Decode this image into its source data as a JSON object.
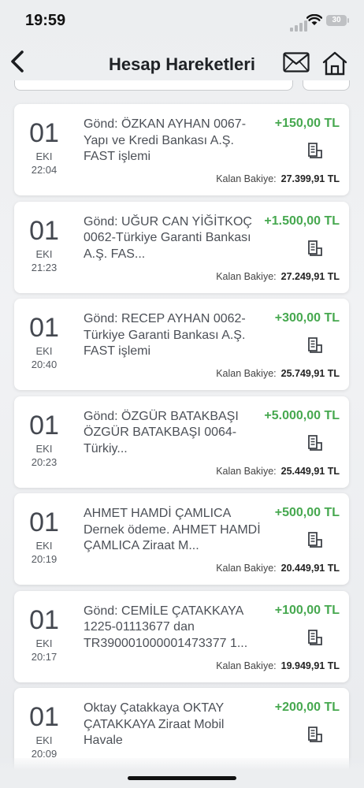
{
  "status_bar": {
    "time": "19:59",
    "battery": "30"
  },
  "header": {
    "title": "Hesap Hareketleri"
  },
  "transactions": [
    {
      "day": "01",
      "month": "EKI",
      "time": "22:04",
      "description": "Gönd: ÖZKAN AYHAN 0067-Yapı ve Kredi Bankası A.Ş. FAST işlemi",
      "amount": "+150,00 TL",
      "balance_label": "Kalan Bakiye:",
      "balance": "27.399,91 TL"
    },
    {
      "day": "01",
      "month": "EKI",
      "time": "21:23",
      "description": "Gönd: UĞUR CAN YİĞİTKOÇ 0062-Türkiye Garanti Bankası A.Ş. FAS...",
      "amount": "+1.500,00 TL",
      "balance_label": "Kalan Bakiye:",
      "balance": "27.249,91 TL"
    },
    {
      "day": "01",
      "month": "EKI",
      "time": "20:40",
      "description": "Gönd: RECEP AYHAN 0062-Türkiye Garanti Bankası A.Ş. FAST işlemi",
      "amount": "+300,00 TL",
      "balance_label": "Kalan Bakiye:",
      "balance": "25.749,91 TL"
    },
    {
      "day": "01",
      "month": "EKI",
      "time": "20:23",
      "description": "Gönd: ÖZGÜR BATAKBAŞI ÖZGÜR BATAKBAŞI 0064-Türkiy...",
      "amount": "+5.000,00 TL",
      "balance_label": "Kalan Bakiye:",
      "balance": "25.449,91 TL"
    },
    {
      "day": "01",
      "month": "EKI",
      "time": "20:19",
      "description": "AHMET HAMDİ ÇAMLICA Dernek ödeme. AHMET HAMDİ ÇAMLICA Ziraat M...",
      "amount": "+500,00 TL",
      "balance_label": "Kalan Bakiye:",
      "balance": "20.449,91 TL"
    },
    {
      "day": "01",
      "month": "EKI",
      "time": "20:17",
      "description": "Gönd: CEMİLE ÇATAKKAYA 1225-01113677 dan TR390001000001473377 1...",
      "amount": "+100,00 TL",
      "balance_label": "Kalan Bakiye:",
      "balance": "19.949,91 TL"
    },
    {
      "day": "01",
      "month": "EKI",
      "time": "20:09",
      "description": "Oktay Çatakkaya OKTAY ÇATAKKAYA Ziraat Mobil Havale",
      "amount": "+200,00 TL",
      "balance_label": "",
      "balance": ""
    }
  ],
  "colors": {
    "amount": "#46a84f",
    "background": "#eceef0",
    "card": "#ffffff"
  },
  "icons": {
    "back": "chevron-left-icon",
    "mail": "envelope-icon",
    "home": "house-icon",
    "receipt": "receipt-icon"
  }
}
